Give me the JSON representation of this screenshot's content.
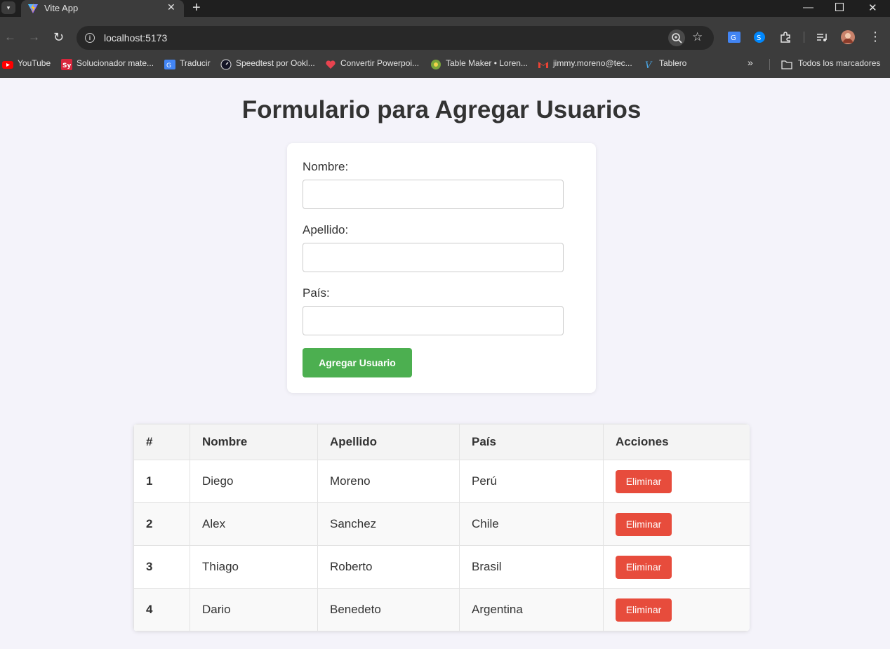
{
  "browser": {
    "tab_title": "Vite App",
    "url": "localhost:5173",
    "bookmarks": [
      {
        "label": "YouTube",
        "icon": "youtube-icon"
      },
      {
        "label": "Solucionador mate...",
        "icon": "symbolab-icon"
      },
      {
        "label": "Traducir",
        "icon": "translate-icon"
      },
      {
        "label": "Speedtest por Ookl...",
        "icon": "speedtest-icon"
      },
      {
        "label": "Convertir Powerpoi...",
        "icon": "heart-icon"
      },
      {
        "label": "Table Maker • Loren...",
        "icon": "table-maker-icon"
      },
      {
        "label": "jimmy.moreno@tec...",
        "icon": "gmail-icon"
      },
      {
        "label": "Tablero",
        "icon": "tablero-icon"
      }
    ],
    "all_bookmarks_label": "Todos los marcadores"
  },
  "page": {
    "title": "Formulario para Agregar Usuarios"
  },
  "form": {
    "nombre_label": "Nombre:",
    "nombre_value": "",
    "apellido_label": "Apellido:",
    "apellido_value": "",
    "pais_label": "País:",
    "pais_value": "",
    "submit_label": "Agregar Usuario"
  },
  "table": {
    "headers": [
      "#",
      "Nombre",
      "Apellido",
      "País",
      "Acciones"
    ],
    "rows": [
      {
        "id": "1",
        "nombre": "Diego",
        "apellido": "Moreno",
        "pais": "Perú",
        "action": "Eliminar"
      },
      {
        "id": "2",
        "nombre": "Alex",
        "apellido": "Sanchez",
        "pais": "Chile",
        "action": "Eliminar"
      },
      {
        "id": "3",
        "nombre": "Thiago",
        "apellido": "Roberto",
        "pais": "Brasil",
        "action": "Eliminar"
      },
      {
        "id": "4",
        "nombre": "Dario",
        "apellido": "Benedeto",
        "pais": "Argentina",
        "action": "Eliminar"
      }
    ]
  },
  "colors": {
    "page_bg": "#f4f3fa",
    "add_button": "#4caf50",
    "delete_button": "#e74c3c",
    "text": "#333333"
  }
}
